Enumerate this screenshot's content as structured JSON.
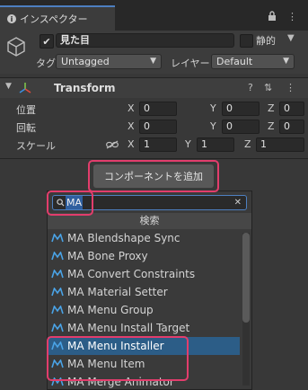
{
  "tab": {
    "label": "インスペクター"
  },
  "gameobject": {
    "name": "見た目",
    "active": true,
    "static_label": "静的",
    "tag_label": "タグ",
    "tag_value": "Untagged",
    "layer_label": "レイヤー",
    "layer_value": "Default"
  },
  "transform": {
    "title": "Transform",
    "rows": [
      {
        "label": "位置",
        "x": "0",
        "y": "0",
        "z": "0"
      },
      {
        "label": "回転",
        "x": "0",
        "y": "0",
        "z": "0"
      },
      {
        "label": "スケール",
        "x": "1",
        "y": "1",
        "z": "1"
      }
    ],
    "axis_labels": [
      "X",
      "Y",
      "Z"
    ]
  },
  "add_component_label": "コンポーネントを追加",
  "popup": {
    "search_value": "MA",
    "header": "検索",
    "items": [
      "MA Blendshape Sync",
      "MA Bone Proxy",
      "MA Convert Constraints",
      "MA Material Setter",
      "MA Menu Group",
      "MA Menu Install Target",
      "MA Menu Installer",
      "MA Menu Item",
      "MA Merge Animator"
    ],
    "selected_index": 6
  },
  "colors": {
    "highlight": "#e23d6c",
    "selection": "#2c5d87",
    "accent": "#4d7fc0"
  }
}
